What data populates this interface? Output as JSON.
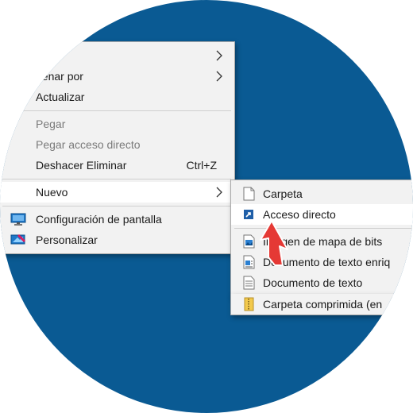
{
  "desktop": {
    "background_color": "#0a5a93"
  },
  "context_menu": {
    "items": [
      {
        "label": "",
        "submenu": true
      },
      {
        "label": "denar por",
        "submenu": true
      },
      {
        "label": "Actualizar"
      },
      {
        "label": "Pegar",
        "disabled": true
      },
      {
        "label": "Pegar acceso directo",
        "disabled": true
      },
      {
        "label": "Deshacer Eliminar",
        "shortcut": "Ctrl+Z"
      },
      {
        "label": "Nuevo",
        "submenu": true,
        "highlighted": true
      },
      {
        "label": "Configuración de pantalla",
        "icon": "display-settings-icon"
      },
      {
        "label": "Personalizar",
        "icon": "personalize-icon"
      }
    ]
  },
  "submenu_nuevo": {
    "items": [
      {
        "label": "Carpeta",
        "icon": "folder-icon"
      },
      {
        "label": "Acceso directo",
        "icon": "shortcut-icon",
        "highlighted": true
      },
      {
        "label": "Imagen de mapa de bits",
        "icon": "bitmap-image-icon"
      },
      {
        "label": "Documento de texto enriq",
        "icon": "rich-text-document-icon"
      },
      {
        "label": "Documento de texto",
        "icon": "text-document-icon"
      },
      {
        "label": "Carpeta comprimida (en",
        "icon": "zip-folder-icon"
      }
    ]
  },
  "annotation": {
    "pointer": "red-arrow-icon",
    "color": "#e53935"
  }
}
